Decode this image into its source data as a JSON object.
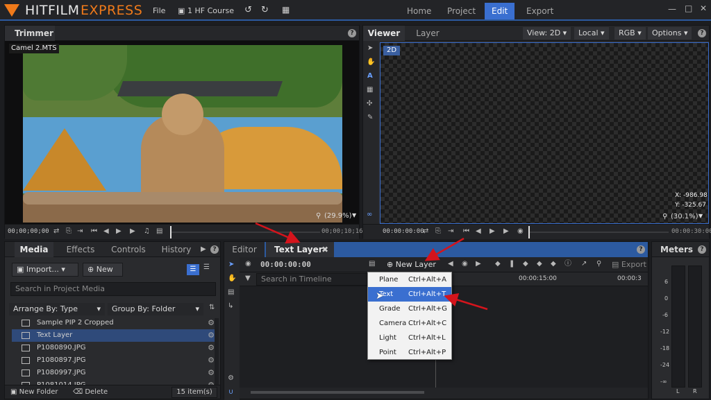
{
  "app": {
    "logo_main": "HITFILM",
    "logo_accent": "EXPRESS"
  },
  "menu": {
    "file": "File",
    "project_name": "1 HF Course"
  },
  "nav_tabs": [
    "Home",
    "Project",
    "Edit",
    "Export"
  ],
  "trimmer": {
    "title": "Trimmer",
    "clip_name": "Camel 2.MTS",
    "zoom": "(29.9%)",
    "timecode_start": "00;00;00;00",
    "timecode_end": "00;00;10;16"
  },
  "viewer": {
    "tabs": [
      "Viewer",
      "Layer"
    ],
    "view_mode": "View: 2D",
    "space": "Local",
    "channel": "RGB",
    "options": "Options",
    "badge": "2D",
    "coord_x": "X:  -986.98",
    "coord_y": "Y:  -325.67",
    "zoom": "(30.1%)",
    "timecode_start": "00:00:00:00",
    "timecode_end": "00:00:30:00"
  },
  "media": {
    "tabs": [
      "Media",
      "Effects",
      "Controls",
      "History"
    ],
    "import_label": "Import...",
    "new_label": "New",
    "search_placeholder": "Search in Project Media",
    "arrange": "Arrange By: Type",
    "group": "Group By: Folder",
    "items": [
      "Sample PIP 2 Cropped",
      "Text Layer",
      "P1080890.JPG",
      "P1080897.JPG",
      "P1080997.JPG",
      "P1081014.JPG"
    ],
    "new_folder": "New Folder",
    "delete": "Delete",
    "count": "15 item(s)"
  },
  "editor": {
    "tabs": [
      "Editor",
      "Text Layer"
    ],
    "timecode": "00:00:00:00",
    "new_layer": "New Layer",
    "export": "Export",
    "search_placeholder": "Search in Timeline",
    "ruler": [
      "00:00:15:00",
      "00:00:3"
    ]
  },
  "new_layer_menu": [
    {
      "label": "Plane",
      "shortcut": "Ctrl+Alt+A"
    },
    {
      "label": "Text",
      "shortcut": "Ctrl+Alt+T"
    },
    {
      "label": "Grade",
      "shortcut": "Ctrl+Alt+G"
    },
    {
      "label": "Camera",
      "shortcut": "Ctrl+Alt+C"
    },
    {
      "label": "Light",
      "shortcut": "Ctrl+Alt+L"
    },
    {
      "label": "Point",
      "shortcut": "Ctrl+Alt+P"
    }
  ],
  "meters": {
    "title": "Meters",
    "scale": [
      "6",
      "0",
      "-6",
      "-12",
      "-18",
      "-24",
      "-∞"
    ],
    "channels": [
      "L",
      "R"
    ]
  },
  "colors": {
    "accent": "#3a6fd0",
    "logo": "#f07a1a",
    "annotation_arrow": "#d4141c"
  }
}
